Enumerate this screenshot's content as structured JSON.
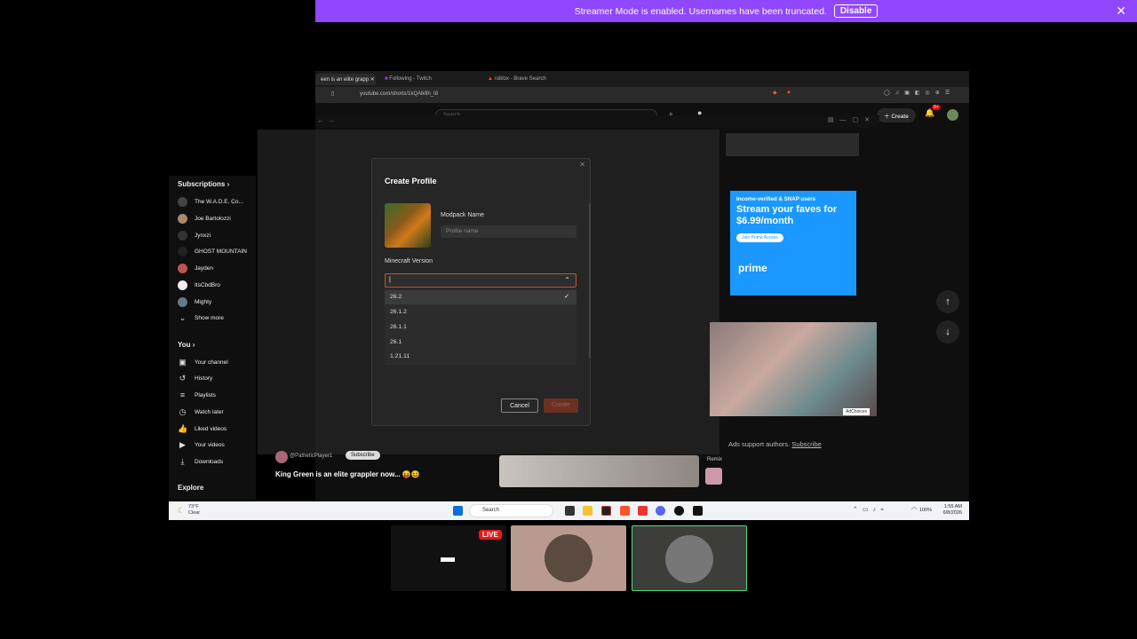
{
  "banner": {
    "message": "Streamer Mode is enabled. Usernames have been truncated.",
    "disable_label": "Disable"
  },
  "browser": {
    "tabs": [
      "een is an elite grapp",
      "Following - Twitch",
      "roblox - Brave Search"
    ],
    "url": "youtube.com/shorts/1kQAlkfih_I8"
  },
  "youtube": {
    "search_placeholder": "Search",
    "create_label": "Create",
    "notification_count": "9+",
    "sidebar": {
      "subscriptions_heading": "Subscriptions",
      "subscriptions": [
        "The W.A.D.E. Co...",
        "Joe Bartolozzi",
        "Jynxzi",
        "GHOST MOUNTAIN",
        "Jayden",
        "ItsCbdBro",
        "Mighty"
      ],
      "show_more": "Show more",
      "you_heading": "You",
      "you_items": [
        "Your channel",
        "History",
        "Playlists",
        "Watch later",
        "Liked videos",
        "Your videos",
        "Downloads"
      ],
      "explore_heading": "Explore"
    },
    "short_title": "King Green is an elite grappler now... 😝😆",
    "channel_handle": "@PatheticPlayer1",
    "subscribe_label": "Subscribe",
    "remix_label": "Remix",
    "ads_note": "Ads support authors.",
    "ads_subscribe": "Subscribe",
    "adchoices": "AdChoices"
  },
  "prime_ad": {
    "line1": "Income-verified & SNAP users",
    "headline": "Stream your faves for $6.99/month",
    "cta": "Join Prime Access",
    "brand": "prime"
  },
  "dialog": {
    "title": "Create Profile",
    "modpack_label": "Modpack Name",
    "modpack_placeholder": "Profile name",
    "version_label": "Minecraft Version",
    "version_value": "|",
    "versions": [
      "26.2",
      "26.1.2",
      "26.1.1",
      "26.1",
      "1.21.11"
    ],
    "selected_version": "26.2",
    "cancel_label": "Cancel",
    "create_label": "Create"
  },
  "taskbar": {
    "weather_temp": "73°F",
    "weather_desc": "Clear",
    "search_label": "Search",
    "battery": "100%",
    "time": "1:55 AM",
    "date": "6/8/2026"
  },
  "stream": {
    "live_label": "LIVE"
  }
}
